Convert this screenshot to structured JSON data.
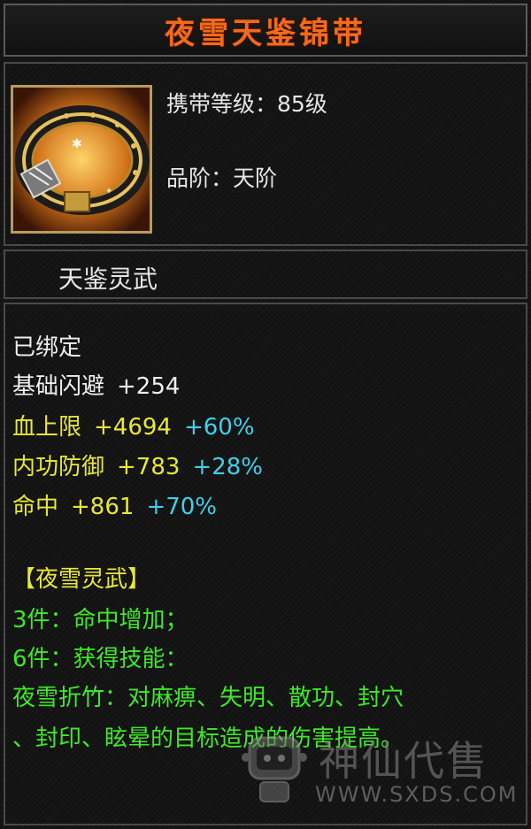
{
  "item": {
    "name": "夜雪天鉴锦带",
    "level_label": "携带等级：85级",
    "grade_label": "品阶：天阶",
    "set_name": "天鉴灵武"
  },
  "stats": {
    "bound": "已绑定",
    "lines": [
      {
        "name": "基础闪避",
        "value": "+254",
        "pct": ""
      },
      {
        "name": "血上限",
        "value": "+4694",
        "pct": "+60%"
      },
      {
        "name": "内功防御",
        "value": "+783",
        "pct": "+28%"
      },
      {
        "name": "命中",
        "value": "+861",
        "pct": "+70%"
      }
    ]
  },
  "set_bonus": {
    "title": "【夜雪灵武】",
    "piece3": "3件：命中增加；",
    "piece6": "6件：获得技能：",
    "skill_line1": "夜雪折竹：对麻痹、失明、散功、封穴",
    "skill_line2": "、封印、眩晕的目标造成的伤害提高。"
  },
  "watermark": {
    "logo_text": "神仙代售",
    "url": "WWW.SXDS.COM"
  },
  "colors": {
    "title": "#f16b1c",
    "stat_value": "#e8e838",
    "stat_pct": "#3fd0e8",
    "set_title": "#e8e838",
    "set_text": "#3fe82a"
  },
  "icons": {
    "item_icon": "golden-belt-icon",
    "watermark_mascot": "robot-mascot-icon"
  }
}
